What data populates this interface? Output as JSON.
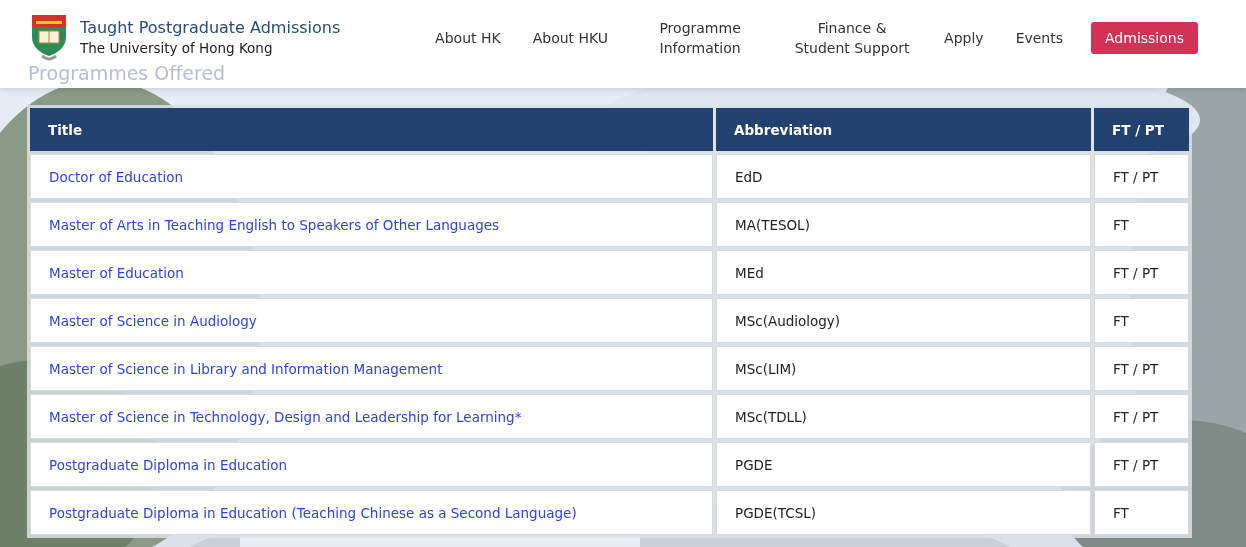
{
  "header": {
    "title": "Taught Postgraduate Admissions",
    "subtitle": "The University of Hong Kong"
  },
  "nav": [
    {
      "label": "About HK",
      "kind": "link"
    },
    {
      "label": "About HKU",
      "kind": "link"
    },
    {
      "label": "Programme Information",
      "kind": "link"
    },
    {
      "label": "Finance & Student Support",
      "kind": "link"
    },
    {
      "label": "Apply",
      "kind": "link"
    },
    {
      "label": "Events",
      "kind": "link"
    },
    {
      "label": "Admissions",
      "kind": "button"
    }
  ],
  "section_heading": "Programmes Offered",
  "table": {
    "columns": [
      "Title",
      "Abbreviation",
      "FT / PT"
    ],
    "rows": [
      [
        "Doctor of Education",
        "EdD",
        "FT / PT"
      ],
      [
        "Master of Arts in Teaching English to Speakers of Other Languages",
        "MA(TESOL)",
        "FT"
      ],
      [
        "Master of Education",
        "MEd",
        "FT / PT"
      ],
      [
        "Master of Science in Audiology",
        "MSc(Audiology)",
        "FT"
      ],
      [
        "Master of Science in Library and Information Management",
        "MSc(LIM)",
        "FT / PT"
      ],
      [
        "Master of Science in Technology, Design and Leadership for Learning*",
        "MSc(TDLL)",
        "FT / PT"
      ],
      [
        "Postgraduate Diploma in Education",
        "PGDE",
        "FT / PT"
      ],
      [
        "Postgraduate Diploma in Education (Teaching Chinese as a Second Language)",
        "PGDE(TCSL)",
        "FT"
      ]
    ]
  }
}
